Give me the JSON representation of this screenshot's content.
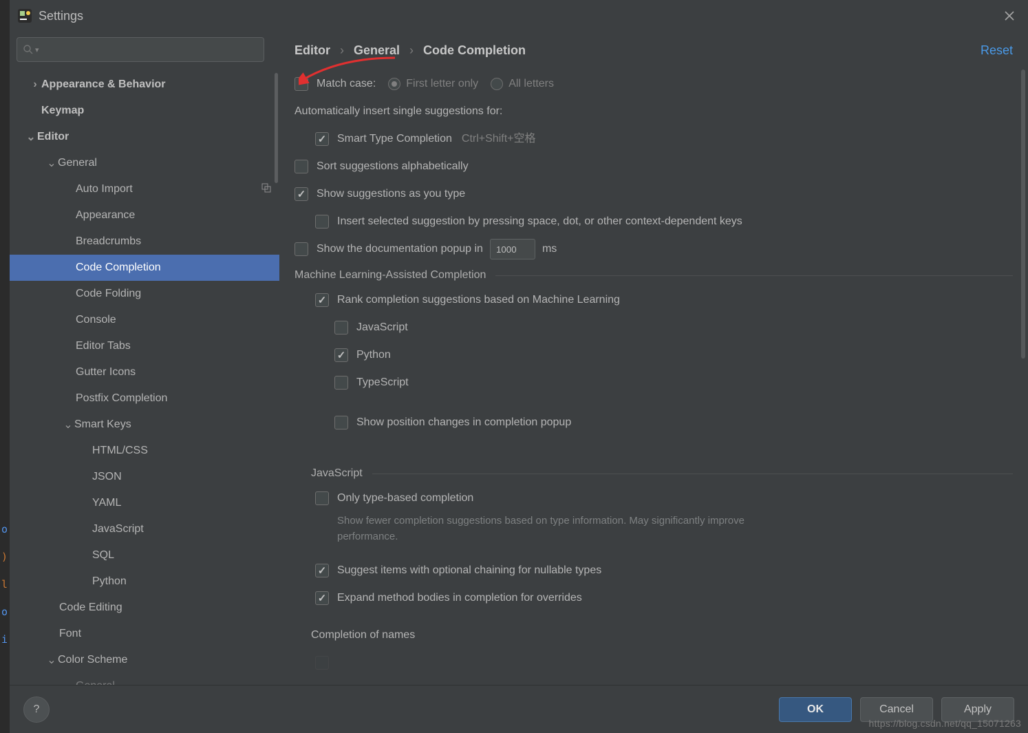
{
  "window": {
    "title": "Settings"
  },
  "breadcrumb": {
    "a": "Editor",
    "b": "General",
    "c": "Code Completion",
    "reset": "Reset"
  },
  "tree": {
    "appearance_behavior": "Appearance & Behavior",
    "keymap": "Keymap",
    "editor": "Editor",
    "general": "General",
    "auto_import": "Auto Import",
    "appearance": "Appearance",
    "breadcrumbs": "Breadcrumbs",
    "code_completion": "Code Completion",
    "code_folding": "Code Folding",
    "console": "Console",
    "editor_tabs": "Editor Tabs",
    "gutter_icons": "Gutter Icons",
    "postfix_completion": "Postfix Completion",
    "smart_keys": "Smart Keys",
    "html_css": "HTML/CSS",
    "json": "JSON",
    "yaml": "YAML",
    "javascript": "JavaScript",
    "sql": "SQL",
    "python": "Python",
    "code_editing": "Code Editing",
    "font": "Font",
    "color_scheme": "Color Scheme",
    "cs_general": "General"
  },
  "opts": {
    "match_case": "Match case:",
    "first_letter": "First letter only",
    "all_letters": "All letters",
    "auto_insert": "Automatically insert single suggestions for:",
    "smart_type": "Smart Type Completion",
    "smart_type_hint": "Ctrl+Shift+空格",
    "sort_alpha": "Sort suggestions alphabetically",
    "show_as_type": "Show suggestions as you type",
    "insert_selected": "Insert selected suggestion by pressing space, dot, or other context-dependent keys",
    "show_doc_a": "Show the documentation popup in",
    "show_doc_val": "1000",
    "show_doc_b": "ms",
    "ml_title": "Machine Learning-Assisted Completion",
    "ml_rank": "Rank completion suggestions based on Machine Learning",
    "ml_js": "JavaScript",
    "ml_py": "Python",
    "ml_ts": "TypeScript",
    "ml_show_pos": "Show position changes in completion popup",
    "js_title": "JavaScript",
    "js_only_type": "Only type-based completion",
    "js_only_type_hint": "Show fewer completion suggestions based on type information. May significantly improve performance.",
    "js_optional_chain": "Suggest items with optional chaining for nullable types",
    "js_expand_override": "Expand method bodies in completion for overrides",
    "js_completion_names": "Completion of names"
  },
  "buttons": {
    "ok": "OK",
    "cancel": "Cancel",
    "apply": "Apply"
  },
  "watermark": "https://blog.csdn.net/qq_15071263"
}
